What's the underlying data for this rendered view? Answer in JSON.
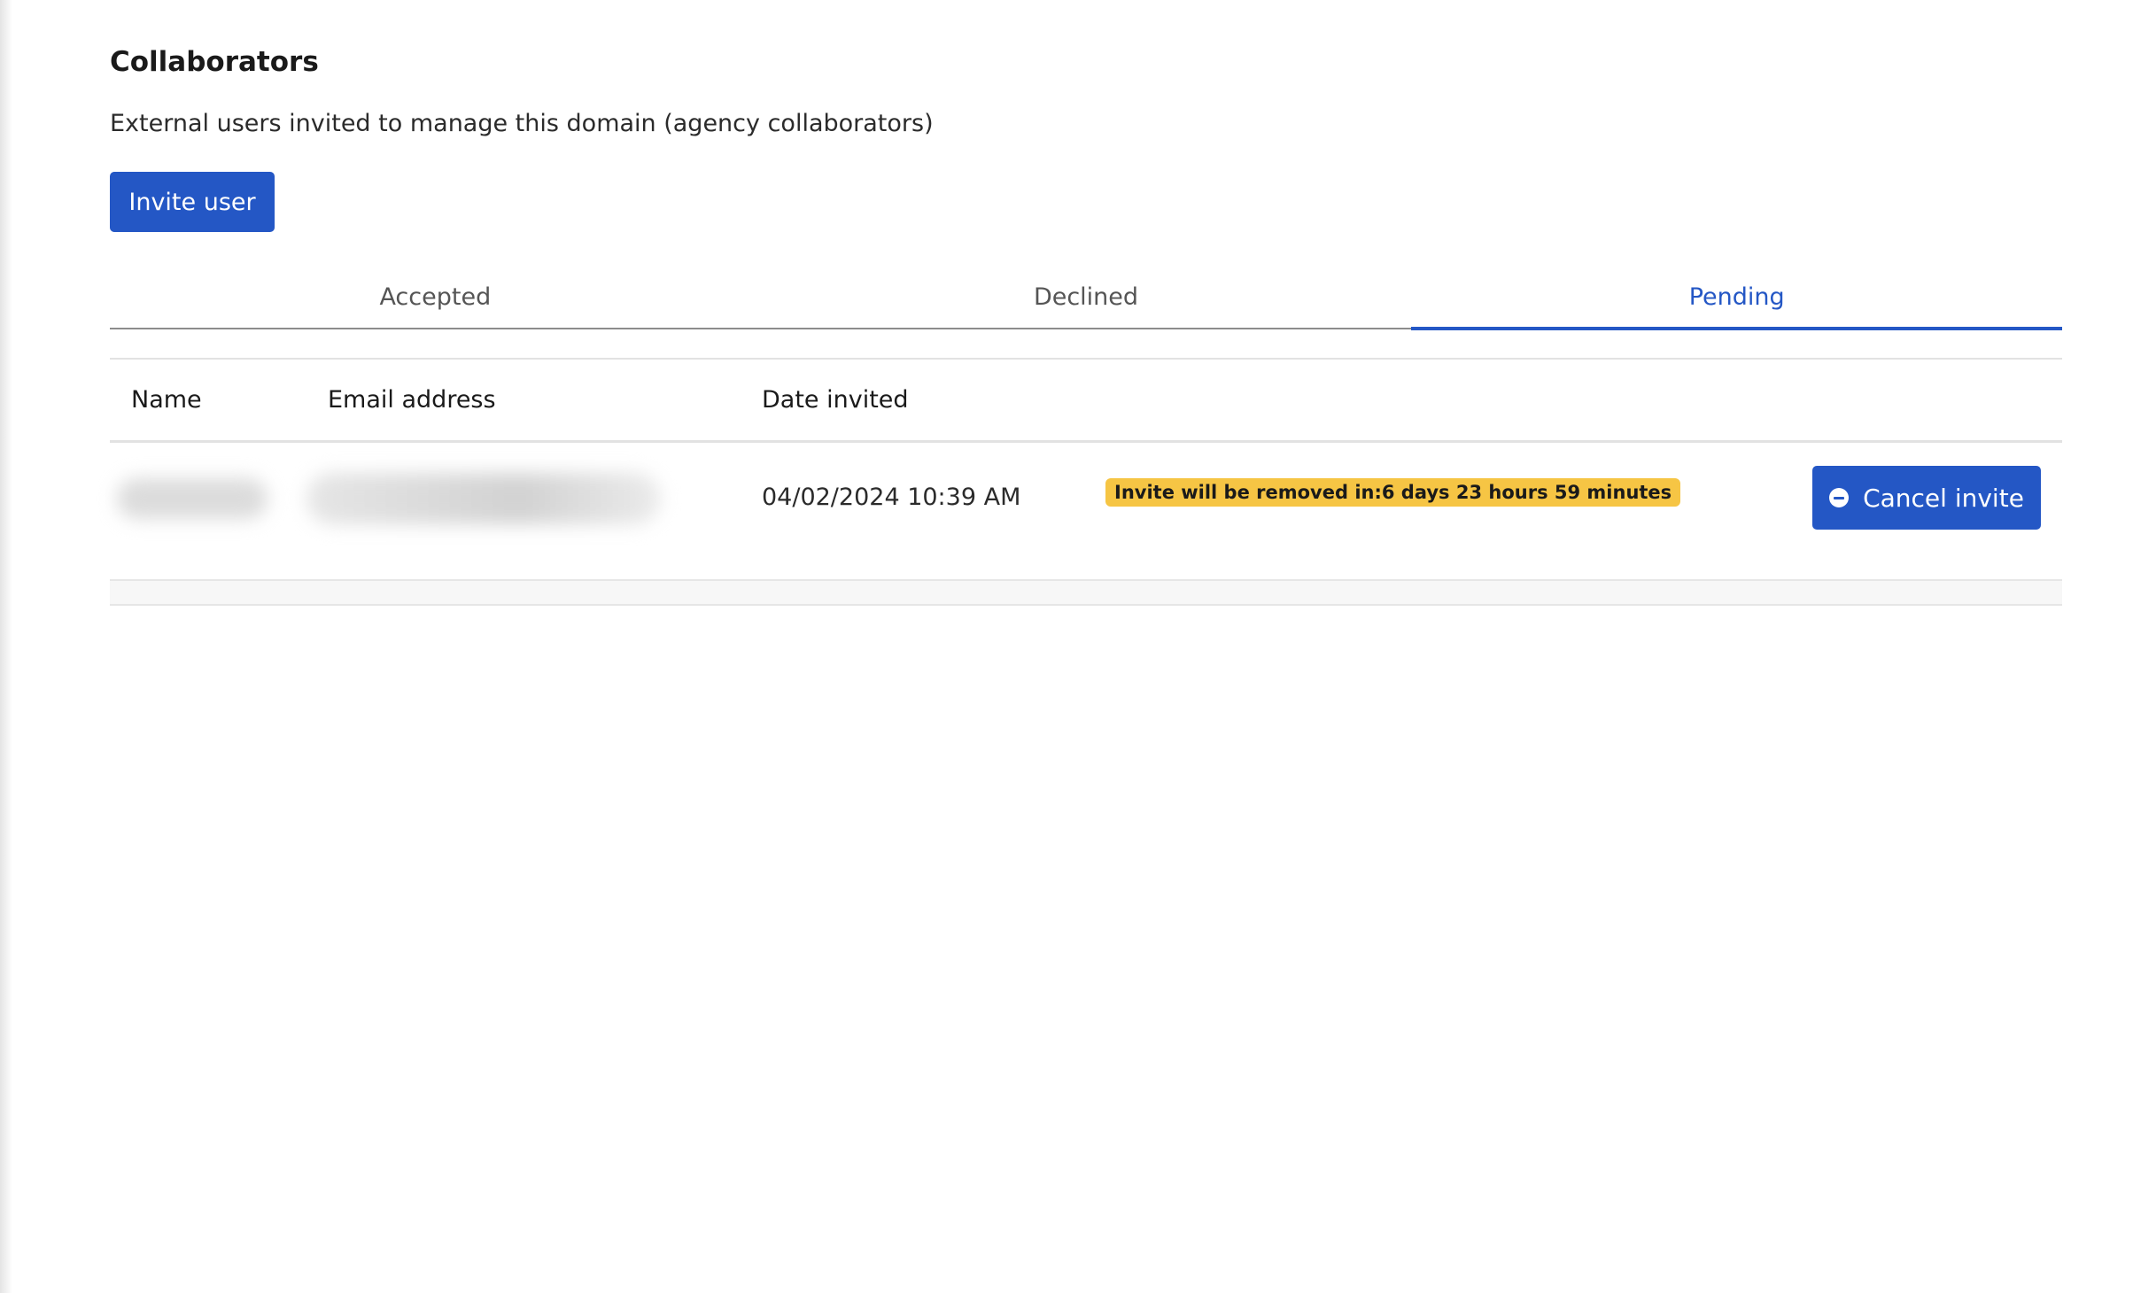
{
  "header": {
    "title": "Collaborators",
    "subtitle": "External users invited to manage this domain (agency collaborators)"
  },
  "actions": {
    "invite_label": "Invite user"
  },
  "tabs": [
    {
      "label": "Accepted",
      "active": false
    },
    {
      "label": "Declined",
      "active": false
    },
    {
      "label": "Pending",
      "active": true
    }
  ],
  "table": {
    "columns": [
      "Name",
      "Email address",
      "Date invited"
    ],
    "rows": [
      {
        "name": "",
        "email": "",
        "date_invited": "04/02/2024 10:39 AM",
        "status_badge": "Invite will be removed in:6 days 23 hours 59 minutes",
        "action_label": "Cancel invite",
        "action_icon": "minus-circle-icon"
      }
    ]
  },
  "colors": {
    "accent": "#2457c5",
    "badge": "#f6c544"
  }
}
